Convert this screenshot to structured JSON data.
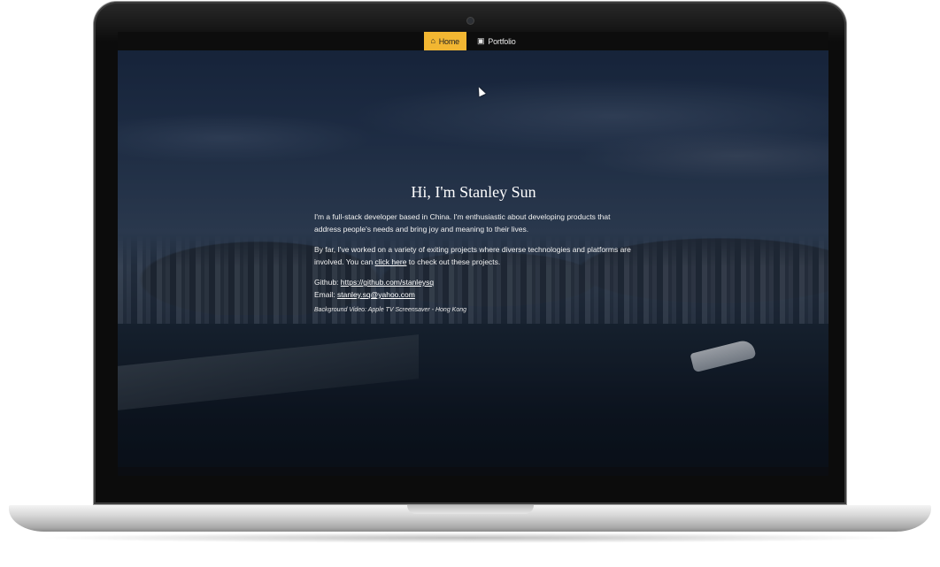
{
  "nav": {
    "items": [
      {
        "label": "Home",
        "icon": "home-icon",
        "active": true
      },
      {
        "label": "Portfolio",
        "icon": "briefcase-icon",
        "active": false
      }
    ]
  },
  "hero": {
    "title": "Hi, I'm Stanley Sun",
    "intro": "I'm a full-stack developer based in China. I'm enthusiastic about developing products that address people's needs and bring joy and meaning to their lives.",
    "projects_prefix": "By far, I've worked on a variety of exiting projects where diverse technologies and platforms are involved. You can ",
    "projects_link": "click here",
    "projects_suffix": " to check out these projects.",
    "github_label": "Github: ",
    "github_link": "https://github.com/stanleysq",
    "email_label": "Email: ",
    "email_link": "stanley.sq@yahoo.com",
    "credit": "Background Video: Apple TV Screensaver - Hong Kong"
  },
  "colors": {
    "accent": "#f2b632",
    "nav_bg": "#0d0d0d",
    "text": "#f1f1f1"
  }
}
